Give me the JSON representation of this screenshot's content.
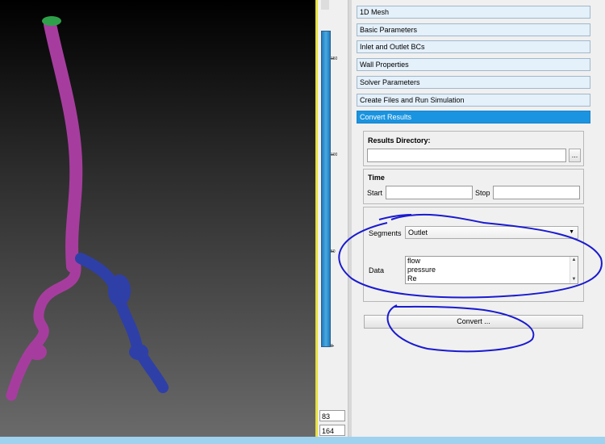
{
  "viewport": {
    "colors": {
      "vessel_main": "#a63d9e",
      "vessel_branch": "#2f3fa8",
      "inlet_cap": "#2ea04a"
    }
  },
  "slider": {
    "ticks": [
      "150",
      "100",
      "50",
      "0"
    ],
    "value_top": "83",
    "value_bottom": "164"
  },
  "sections": [
    {
      "label": "1D Mesh"
    },
    {
      "label": "Basic Parameters"
    },
    {
      "label": "Inlet and Outlet BCs"
    },
    {
      "label": "Wall Properties"
    },
    {
      "label": "Solver Parameters"
    },
    {
      "label": "Create Files and Run Simulation"
    },
    {
      "label": "Convert Results"
    }
  ],
  "results_dir": {
    "title": "Results Directory:",
    "value": "",
    "browse_label": "..."
  },
  "time": {
    "title": "Time",
    "start_label": "Start",
    "stop_label": "Stop",
    "start_value": "",
    "stop_value": ""
  },
  "segments": {
    "label": "Segments",
    "selected": "Outlet"
  },
  "data_list": {
    "label": "Data",
    "items": [
      "flow",
      "pressure",
      "Re"
    ]
  },
  "convert_button": {
    "label": "Convert ..."
  },
  "colors": {
    "active_section": "#1a94e0",
    "annotation": "#1a1ad0"
  }
}
